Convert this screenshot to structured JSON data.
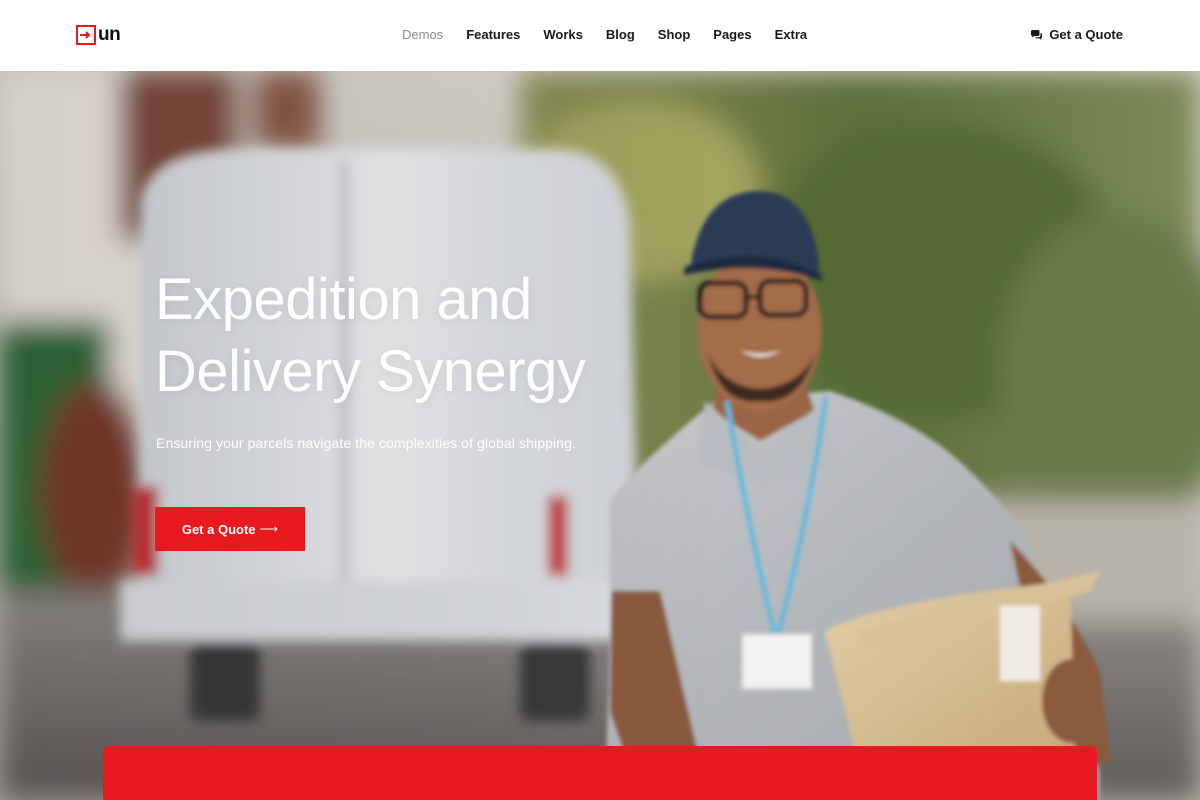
{
  "header": {
    "logo_text": "un",
    "nav": [
      {
        "label": "Demos",
        "active": true
      },
      {
        "label": "Features",
        "active": false
      },
      {
        "label": "Works",
        "active": false
      },
      {
        "label": "Blog",
        "active": false
      },
      {
        "label": "Shop",
        "active": false
      },
      {
        "label": "Pages",
        "active": false
      },
      {
        "label": "Extra",
        "active": false
      }
    ],
    "quote_label": "Get a Quote",
    "quote_icon": "chat-icon"
  },
  "hero": {
    "title_line1": "Expedition and",
    "title_line2": "Delivery Synergy",
    "subtitle": "Ensuring your parcels navigate the complexities of global shipping.",
    "button_label": "Get a Quote",
    "button_arrow": "⟶"
  },
  "colors": {
    "accent": "#e8191f",
    "text_dark": "#1a1a1a",
    "nav_active": "#8a8a8a"
  }
}
